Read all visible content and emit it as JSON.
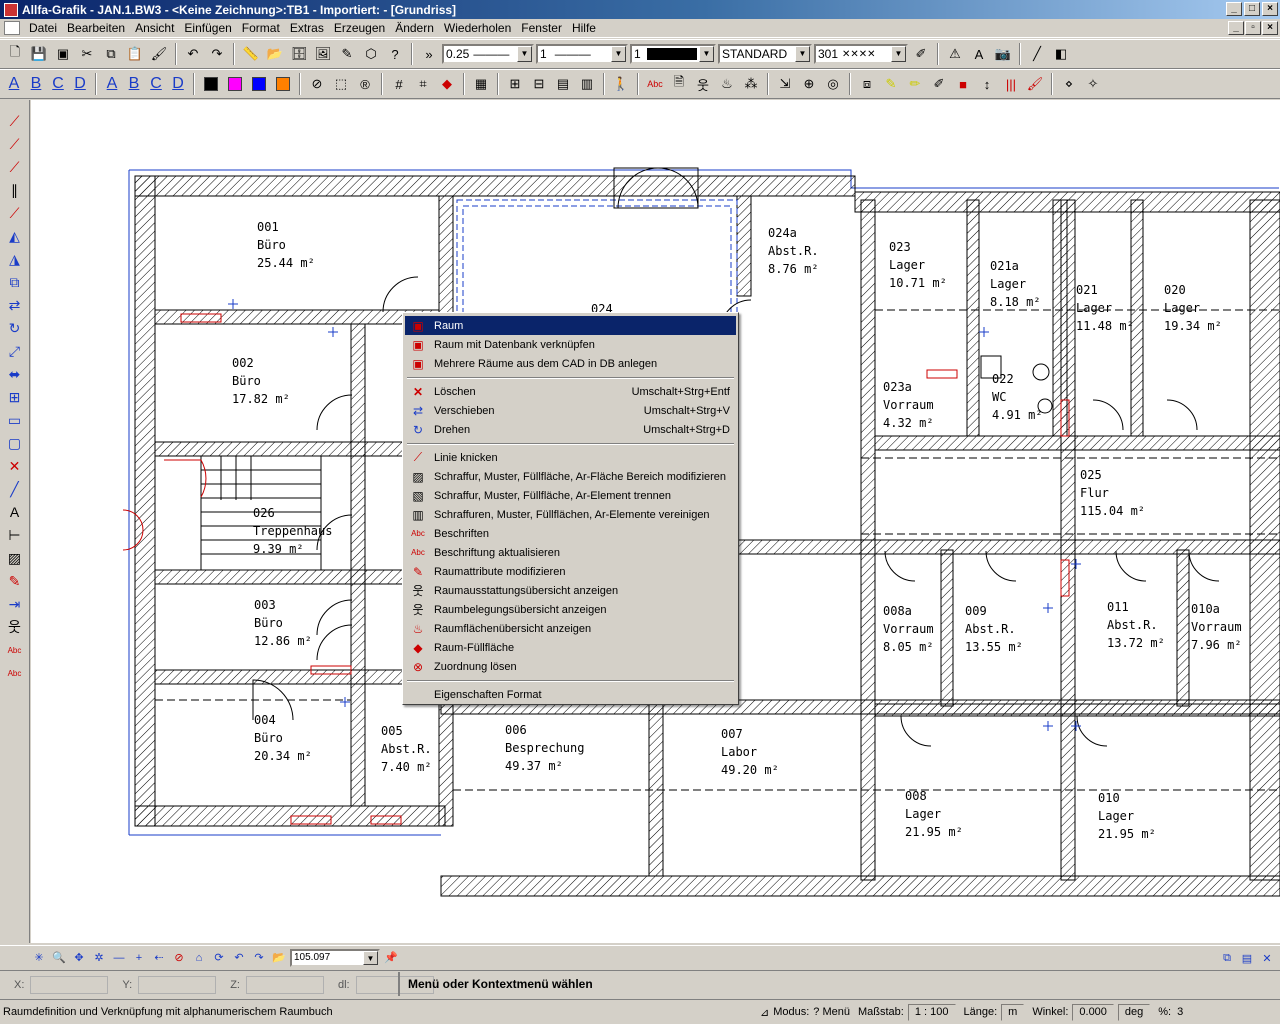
{
  "window": {
    "title": "Allfa-Grafik - JAN.1.BW3 - <Keine Zeichnung>:TB1 - Importiert: - [Grundriss]"
  },
  "menubar": {
    "items": [
      "Datei",
      "Bearbeiten",
      "Ansicht",
      "Einfügen",
      "Format",
      "Extras",
      "Erzeugen",
      "Ändern",
      "Wiederholen",
      "Fenster",
      "Hilfe"
    ]
  },
  "toolbar": {
    "line_width": "0.25",
    "line_type": "1",
    "pen": "1",
    "style": "STANDARD",
    "hatch": "301"
  },
  "format_toolbar": {
    "letters": [
      "A",
      "B",
      "C",
      "D",
      "A",
      "B",
      "C",
      "D"
    ],
    "colors": [
      "#000000",
      "#ff00ff",
      "#0000ff",
      "#ff8000"
    ]
  },
  "rooms": [
    {
      "number": "001",
      "name": "Büro",
      "area": "25.44 m²"
    },
    {
      "number": "002",
      "name": "Büro",
      "area": "17.82 m²"
    },
    {
      "number": "026",
      "name": "Treppenhaus",
      "area": "9.39 m²"
    },
    {
      "number": "003",
      "name": "Büro",
      "area": "12.86 m²"
    },
    {
      "number": "004",
      "name": "Büro",
      "area": "20.34 m²"
    },
    {
      "number": "005",
      "name": "Abst.R.",
      "area": "7.40 m²"
    },
    {
      "number": "006",
      "name": "Besprechung",
      "area": "49.37 m²"
    },
    {
      "number": "007",
      "name": "Labor",
      "area": "49.20 m²"
    },
    {
      "number": "024",
      "name": "",
      "area": ""
    },
    {
      "number": "024a",
      "name": "Abst.R.",
      "area": "8.76 m²"
    },
    {
      "number": "023",
      "name": "Lager",
      "area": "10.71 m²"
    },
    {
      "number": "021a",
      "name": "Lager",
      "area": "8.18 m²"
    },
    {
      "number": "021",
      "name": "Lager",
      "area": "11.48 m²"
    },
    {
      "number": "020",
      "name": "Lager",
      "area": "19.34 m²"
    },
    {
      "number": "023a",
      "name": "Vorraum",
      "area": "4.32 m²"
    },
    {
      "number": "022",
      "name": "WC",
      "area": "4.91 m²"
    },
    {
      "number": "025",
      "name": "Flur",
      "area": "115.04 m²"
    },
    {
      "number": "008a",
      "name": "Vorraum",
      "area": "8.05 m²"
    },
    {
      "number": "009",
      "name": "Abst.R.",
      "area": "13.55 m²"
    },
    {
      "number": "011",
      "name": "Abst.R.",
      "area": "13.72 m²"
    },
    {
      "number": "010a",
      "name": "Vorraum",
      "area": "7.96 m²"
    },
    {
      "number": "008",
      "name": "Lager",
      "area": "21.95 m²"
    },
    {
      "number": "010",
      "name": "Lager",
      "area": "21.95 m²"
    }
  ],
  "context_menu": {
    "group1": [
      {
        "label": "Raum",
        "shortcut": "",
        "icon": "room-icon"
      },
      {
        "label": "Raum mit Datenbank verknüpfen",
        "shortcut": "",
        "icon": "room-db-icon"
      },
      {
        "label": "Mehrere Räume aus dem CAD in DB anlegen",
        "shortcut": "",
        "icon": "rooms-db-icon"
      }
    ],
    "group2": [
      {
        "label": "Löschen",
        "shortcut": "Umschalt+Strg+Entf",
        "icon": "delete-icon"
      },
      {
        "label": "Verschieben",
        "shortcut": "Umschalt+Strg+V",
        "icon": "move-icon"
      },
      {
        "label": "Drehen",
        "shortcut": "Umschalt+Strg+D",
        "icon": "rotate-icon"
      }
    ],
    "group3": [
      {
        "label": "Linie knicken",
        "shortcut": "",
        "icon": "bend-line-icon"
      },
      {
        "label": "Schraffur, Muster, Füllfläche, Ar-Fläche Bereich modifizieren",
        "shortcut": "",
        "icon": "hatch-modify-icon"
      },
      {
        "label": "Schraffur, Muster, Füllfläche, Ar-Element trennen",
        "shortcut": "",
        "icon": "hatch-split-icon"
      },
      {
        "label": "Schraffuren, Muster, Füllflächen, Ar-Elemente vereinigen",
        "shortcut": "",
        "icon": "hatch-merge-icon"
      },
      {
        "label": "Beschriften",
        "shortcut": "",
        "icon": "label-icon"
      },
      {
        "label": "Beschriftung aktualisieren",
        "shortcut": "",
        "icon": "label-update-icon"
      },
      {
        "label": "Raumattribute modifizieren",
        "shortcut": "",
        "icon": "room-attr-icon"
      },
      {
        "label": "Raumausstattungsübersicht anzeigen",
        "shortcut": "",
        "icon": "equipment-icon"
      },
      {
        "label": "Raumbelegungsübersicht anzeigen",
        "shortcut": "",
        "icon": "occupancy-icon"
      },
      {
        "label": "Raumflächenübersicht anzeigen",
        "shortcut": "",
        "icon": "area-overview-icon"
      },
      {
        "label": "Raum-Füllfläche",
        "shortcut": "",
        "icon": "fill-icon"
      },
      {
        "label": "Zuordnung lösen",
        "shortcut": "",
        "icon": "unassign-icon"
      }
    ],
    "group4": [
      {
        "label": "Eigenschaften Format",
        "shortcut": "",
        "icon": "properties-icon"
      }
    ]
  },
  "zoombar": {
    "zoom_value": "105.097"
  },
  "coords": {
    "x_label": "X:",
    "y_label": "Y:",
    "z_label": "Z:",
    "dl_label": "dl:"
  },
  "prompt": "Menü oder Kontextmenü wählen",
  "status": {
    "message": "Raumdefinition und Verknüpfung mit alphanumerischem Raumbuch",
    "mode_label": "Modus:",
    "mode_value": "? Menü",
    "scale_label": "Maßstab:",
    "scale_value": "1 : 100",
    "length_label": "Länge:",
    "length_value": "m",
    "angle_label": "Winkel:",
    "angle_value": "0.000",
    "angle_unit": "deg",
    "percent_label": "%:",
    "percent_value": "3"
  }
}
